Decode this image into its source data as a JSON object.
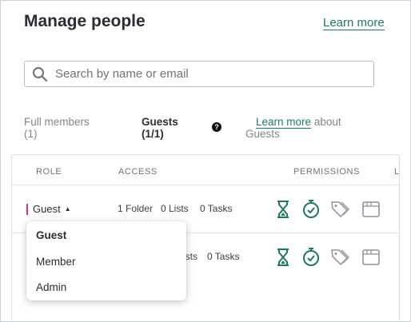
{
  "header": {
    "title": "Manage people",
    "learn_more": "Learn more"
  },
  "search": {
    "placeholder": "Search by name or email"
  },
  "tabs": {
    "full_members_line1": "Full members",
    "full_members_line2": "(1)",
    "guests_line1": "Guests",
    "guests_line2": "(1/1)",
    "help_glyph": "?",
    "learn_more_link": "Learn more",
    "learn_more_suffix": "about",
    "learn_more_suffix2": "Guests"
  },
  "table": {
    "headers": {
      "role": "ROLE",
      "access": "ACCESS",
      "permissions": "PERMISSIONS",
      "last": "L"
    },
    "rows": [
      {
        "role": "Guest",
        "folders": "1 Folder",
        "lists": "0 Lists",
        "tasks": "0 Tasks"
      },
      {
        "lists_partial": "ists",
        "tasks": "0 Tasks"
      }
    ],
    "permission_icons": [
      "hourglass-icon",
      "stopwatch-icon",
      "tags-icon",
      "browser-window-icon"
    ]
  },
  "role_dropdown": {
    "options": [
      "Guest",
      "Member",
      "Admin"
    ],
    "selected": "Guest"
  },
  "colors": {
    "accent_green": "#1f7a5c",
    "role_bar_pink": "#e0306d",
    "muted_icon": "#9aa0a8"
  }
}
